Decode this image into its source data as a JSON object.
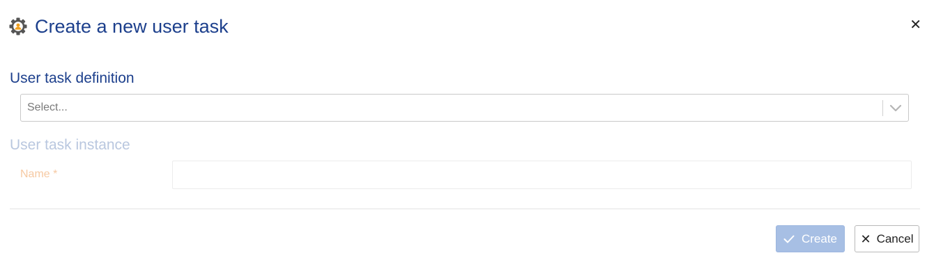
{
  "dialog": {
    "title": "Create a new user task",
    "icon": "gear-user-icon",
    "close_icon": "close-icon",
    "close_glyph": "✕"
  },
  "definition_section": {
    "title": "User task definition",
    "select": {
      "placeholder": "Select...",
      "icon": "chevron-down-icon"
    }
  },
  "instance_section": {
    "title": "User task instance",
    "name_label": "Name *",
    "name_value": ""
  },
  "footer": {
    "create_label": "Create",
    "create_icon": "check-icon",
    "cancel_label": "Cancel",
    "cancel_icon": "close-icon",
    "cancel_glyph": "✕"
  },
  "colors": {
    "title_blue": "#1c3f8c",
    "disabled_heading": "#b9c7df",
    "required_label": "#f6c9a2",
    "create_button_disabled": "#a7bfe4"
  }
}
